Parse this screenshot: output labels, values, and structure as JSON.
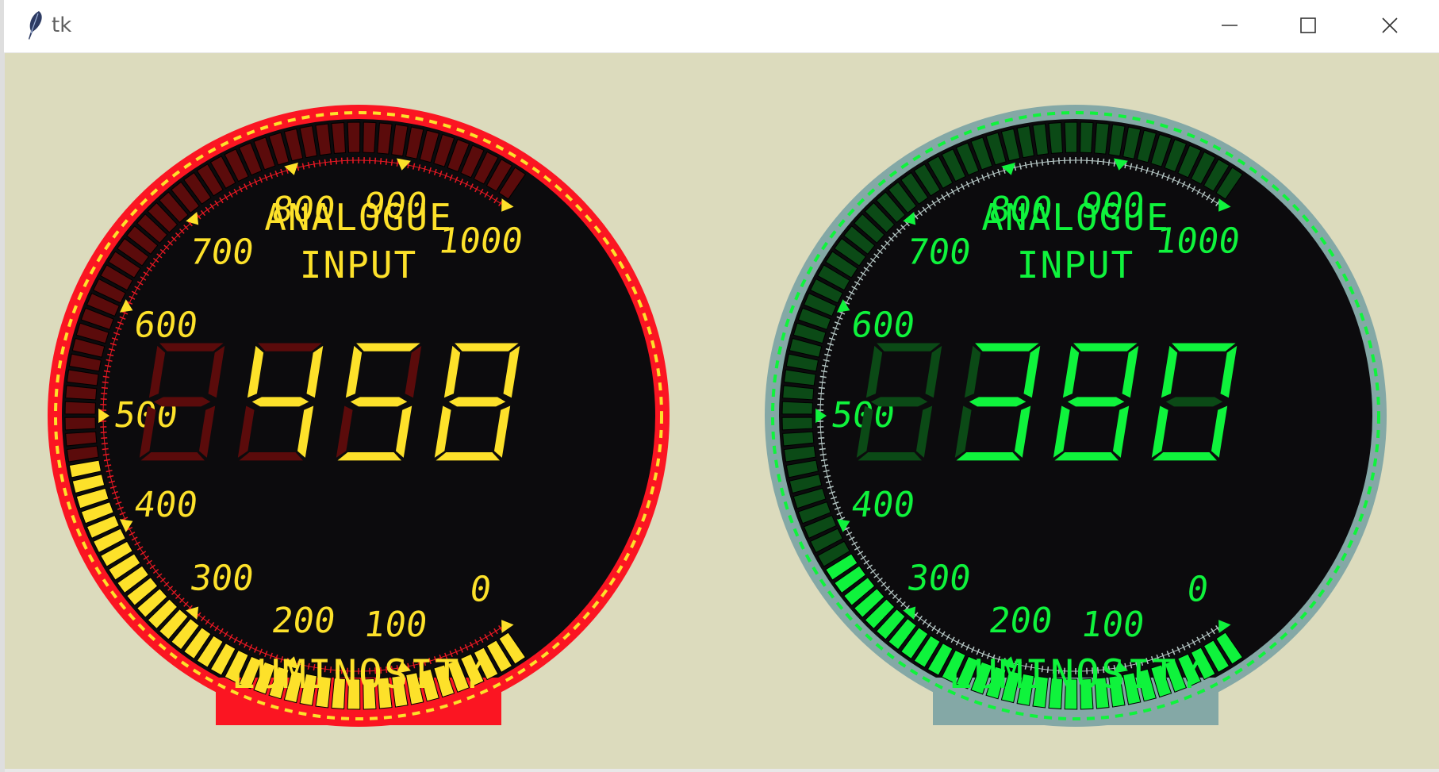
{
  "window": {
    "title": "tk",
    "icons": {
      "app": "feather-icon",
      "minimize": "minimize-icon",
      "maximize": "maximize-icon",
      "close": "close-icon"
    }
  },
  "canvas": {
    "background": "#dcdbbd"
  },
  "gauges": [
    {
      "label_top": "ANALOGUE",
      "label_mid": "INPUT",
      "label_bottom": "LUMINOSITY",
      "value": 458,
      "display": {
        "digits": [
          " ",
          "4",
          "5",
          "8"
        ]
      },
      "scale": {
        "min": 0,
        "max": 1000,
        "labels": [
          "0",
          "100",
          "200",
          "300",
          "400",
          "500",
          "600",
          "700",
          "800",
          "900",
          "1000"
        ]
      },
      "colors": {
        "ring": "#fb1522",
        "on": "#fde12a",
        "off": "#5b0b0b",
        "face": "#0c0b0d",
        "tick": "#e81823"
      }
    },
    {
      "label_top": "ANALOGUE",
      "label_mid": "INPUT",
      "label_bottom": "LUMINOSITY",
      "value": 380,
      "display": {
        "digits": [
          " ",
          "3",
          "8",
          "0"
        ]
      },
      "scale": {
        "min": 0,
        "max": 1000,
        "labels": [
          "0",
          "100",
          "200",
          "300",
          "400",
          "500",
          "600",
          "700",
          "800",
          "900",
          "1000"
        ]
      },
      "colors": {
        "ring": "#84a8a6",
        "on": "#0ff33c",
        "off": "#0b4a16",
        "face": "#0c0b0d",
        "tick": "#b5c6c4"
      }
    }
  ]
}
